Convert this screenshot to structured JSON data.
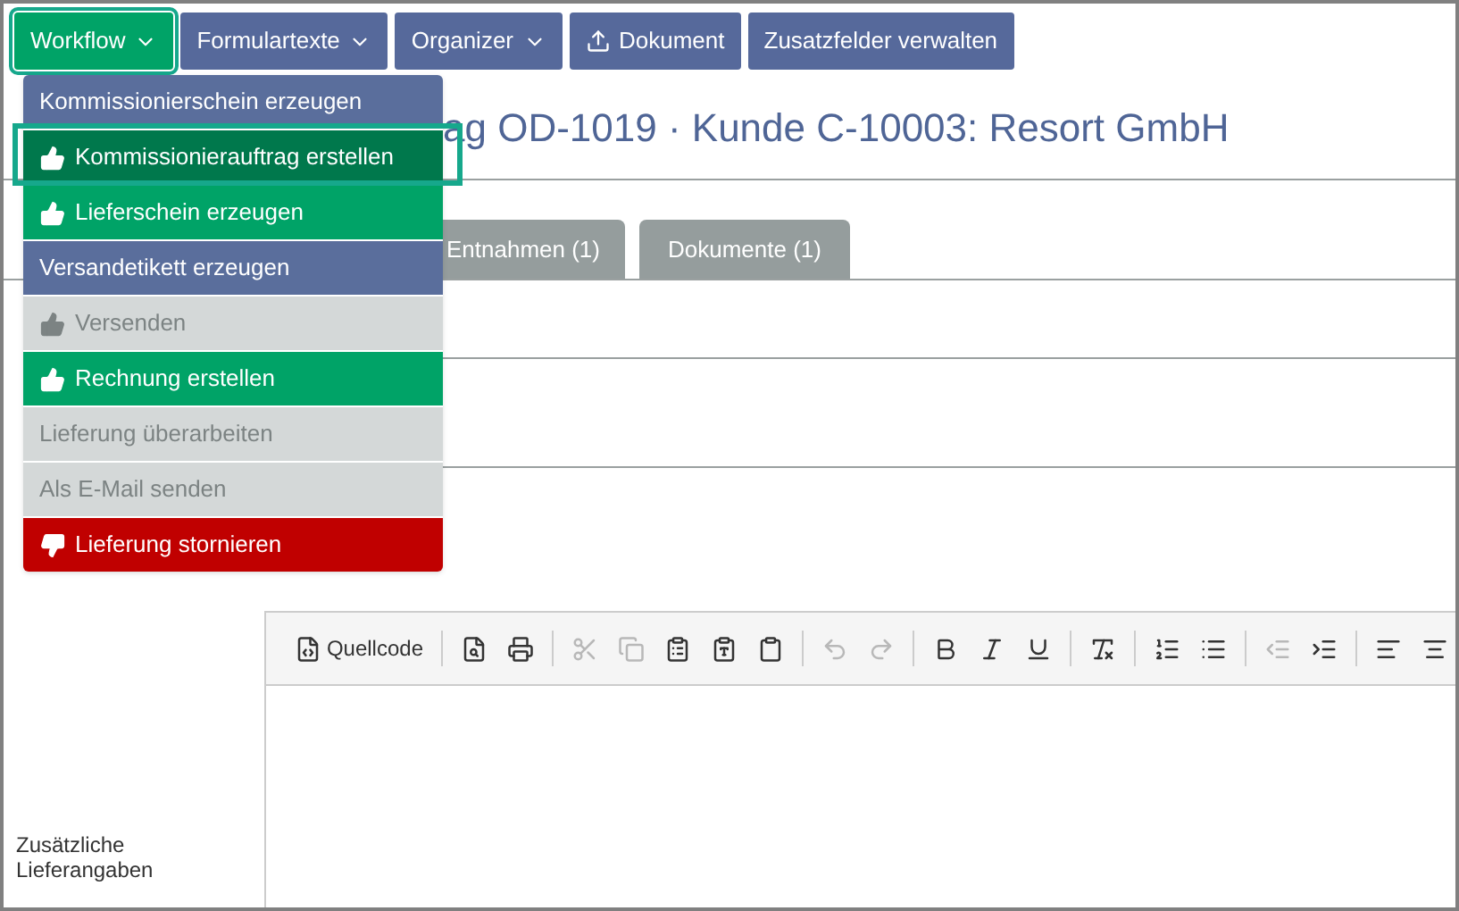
{
  "toolbar": [
    {
      "label": "Workflow",
      "kind": "dropdown",
      "selected": true
    },
    {
      "label": "Formulartexte",
      "kind": "dropdown",
      "selected": false
    },
    {
      "label": "Organizer",
      "kind": "dropdown",
      "selected": false
    },
    {
      "label": "Dokument",
      "kind": "upload",
      "selected": false
    },
    {
      "label": "Zusatzfelder verwalten",
      "kind": "plain",
      "selected": false
    }
  ],
  "workflow_menu": [
    {
      "label": "Kommissionierschein erzeugen",
      "kind": "action",
      "disabled": false,
      "selected": false
    },
    {
      "label": "Kommissionierauftrag erstellen",
      "kind": "approve",
      "disabled": false,
      "selected": true
    },
    {
      "label": "Lieferschein erzeugen",
      "kind": "approve",
      "disabled": false,
      "selected": false
    },
    {
      "label": "Versandetikett erzeugen",
      "kind": "action",
      "disabled": false,
      "selected": false
    },
    {
      "label": "Versenden",
      "kind": "approve",
      "disabled": true,
      "selected": false
    },
    {
      "label": "Rechnung erstellen",
      "kind": "approve",
      "disabled": false,
      "selected": false
    },
    {
      "label": "Lieferung überarbeiten",
      "kind": "action",
      "disabled": true,
      "selected": false
    },
    {
      "label": "Als E-Mail senden",
      "kind": "action",
      "disabled": true,
      "selected": false
    },
    {
      "label": "Lieferung stornieren",
      "kind": "reject",
      "disabled": false,
      "selected": false
    }
  ],
  "page_title": "ag OD-1019 · Kunde C-10003: Resort GmbH",
  "tabs": [
    {
      "label": "Entnahmen (1)",
      "selected": false
    },
    {
      "label": "Dokumente (1)",
      "selected": false
    }
  ],
  "editor": {
    "label": "Zusätzliche Lieferangaben",
    "toolbar": [
      {
        "label": "Quellcode",
        "disabled": false
      },
      {
        "disabled": false
      },
      {
        "disabled": false
      },
      {
        "disabled": true
      },
      {
        "disabled": true
      },
      {
        "disabled": false
      },
      {
        "disabled": false
      },
      {
        "disabled": false
      },
      {
        "disabled": true
      },
      {
        "disabled": true
      },
      {
        "disabled": false
      },
      {
        "disabled": false
      },
      {
        "disabled": false
      },
      {
        "disabled": false
      },
      {
        "disabled": false
      },
      {
        "disabled": false
      },
      {
        "disabled": true
      },
      {
        "disabled": false
      },
      {
        "disabled": false
      },
      {
        "disabled": false
      }
    ]
  }
}
